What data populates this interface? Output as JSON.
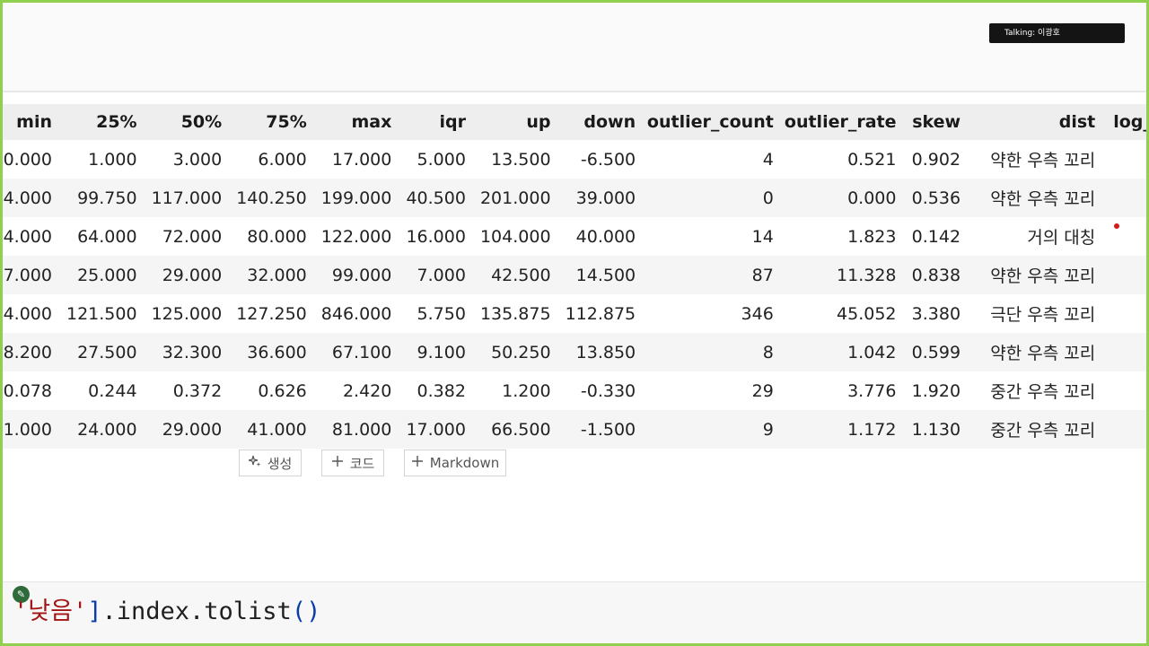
{
  "meeting": {
    "talking_label": "Talking: 이광호"
  },
  "table": {
    "columns": [
      "min",
      "25%",
      "50%",
      "75%",
      "max",
      "iqr",
      "up",
      "down",
      "outlier_count",
      "outlier_rate",
      "skew",
      "dist",
      "log_"
    ],
    "rows": [
      [
        "0.000",
        "1.000",
        "3.000",
        "6.000",
        "17.000",
        "5.000",
        "13.500",
        "-6.500",
        "4",
        "0.521",
        "0.902",
        "약한 우측 꼬리",
        ""
      ],
      [
        "4.000",
        "99.750",
        "117.000",
        "140.250",
        "199.000",
        "40.500",
        "201.000",
        "39.000",
        "0",
        "0.000",
        "0.536",
        "약한 우측 꼬리",
        ""
      ],
      [
        "4.000",
        "64.000",
        "72.000",
        "80.000",
        "122.000",
        "16.000",
        "104.000",
        "40.000",
        "14",
        "1.823",
        "0.142",
        "거의 대칭",
        ""
      ],
      [
        "7.000",
        "25.000",
        "29.000",
        "32.000",
        "99.000",
        "7.000",
        "42.500",
        "14.500",
        "87",
        "11.328",
        "0.838",
        "약한 우측 꼬리",
        ""
      ],
      [
        "4.000",
        "121.500",
        "125.000",
        "127.250",
        "846.000",
        "5.750",
        "135.875",
        "112.875",
        "346",
        "45.052",
        "3.380",
        "극단 우측 꼬리",
        ""
      ],
      [
        "8.200",
        "27.500",
        "32.300",
        "36.600",
        "67.100",
        "9.100",
        "50.250",
        "13.850",
        "8",
        "1.042",
        "0.599",
        "약한 우측 꼬리",
        ""
      ],
      [
        "0.078",
        "0.244",
        "0.372",
        "0.626",
        "2.420",
        "0.382",
        "1.200",
        "-0.330",
        "29",
        "3.776",
        "1.920",
        "중간 우측 꼬리",
        ""
      ],
      [
        "1.000",
        "24.000",
        "29.000",
        "41.000",
        "81.000",
        "17.000",
        "66.500",
        "-1.500",
        "9",
        "1.172",
        "1.130",
        "중간 우측 꼬리",
        ""
      ]
    ]
  },
  "cell_toolbar": {
    "generate_label": "생성",
    "code_label": "코드",
    "markdown_label": "Markdown",
    "generate_icon": "sparkle-icon",
    "plus_icon": "plus-icon"
  },
  "code_cell": {
    "quote_open": "'",
    "string_text": "낮음",
    "quote_close": "'",
    "bracket": "]",
    "method_text": ".index.tolist",
    "paren_open": "(",
    "paren_close": ")"
  },
  "colors": {
    "frame_border": "#8fd14f",
    "string_token": "#a31515",
    "bracket_token": "#0b3da8",
    "talking_badge_bg": "#141414"
  }
}
